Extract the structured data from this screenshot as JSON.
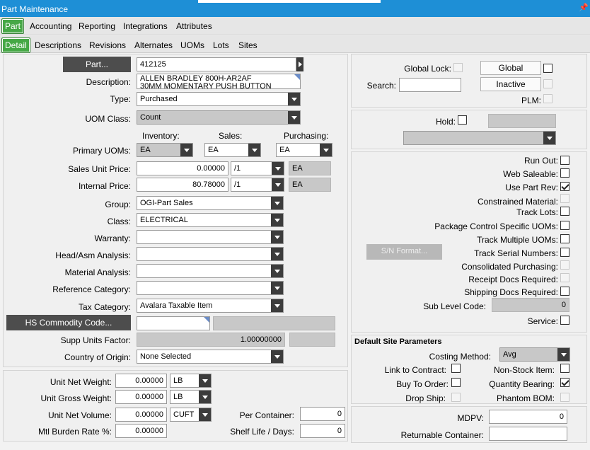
{
  "window": {
    "title": "Part Maintenance",
    "pin_icon": "pin-icon"
  },
  "tabs_main": [
    "Part",
    "Accounting",
    "Reporting",
    "Integrations",
    "Attributes"
  ],
  "tabs_sub": [
    "Detail",
    "Descriptions",
    "Revisions",
    "Alternates",
    "UOMs",
    "Lots",
    "Sites"
  ],
  "part": {
    "part_button": "Part...",
    "part_number": "412125",
    "description_label": "Description:",
    "description_line1": "ALLEN BRADLEY 800H-AR2AF",
    "description_line2": "30MM MOMENTARY PUSH BUTTON",
    "type_label": "Type:",
    "type_value": "Purchased",
    "uom_class_label": "UOM Class:",
    "uom_class_value": "Count",
    "col_inventory": "Inventory:",
    "col_sales": "Sales:",
    "col_purchasing": "Purchasing:",
    "primary_uoms_label": "Primary UOMs:",
    "uom_inventory": "EA",
    "uom_sales": "EA",
    "uom_purchasing": "EA",
    "sales_unit_price_label": "Sales Unit Price:",
    "sales_unit_price": "0.00000",
    "sales_per": "/1",
    "sales_uom": "EA",
    "internal_price_label": "Internal Price:",
    "internal_price": "80.78000",
    "internal_per": "/1",
    "internal_uom": "EA",
    "group_label": "Group:",
    "group_value": "OGI-Part Sales",
    "class_label": "Class:",
    "class_value": "ELECTRICAL",
    "warranty_label": "Warranty:",
    "head_asm_label": "Head/Asm Analysis:",
    "material_analysis_label": "Material Analysis:",
    "reference_category_label": "Reference Category:",
    "tax_category_label": "Tax Category:",
    "tax_category_value": "Avalara Taxable Item",
    "hs_button": "HS Commodity Code...",
    "supp_units_label": "Supp Units Factor:",
    "supp_units_value": "1.00000000",
    "country_label": "Country of Origin:",
    "country_value": "None Selected"
  },
  "weights": {
    "net_weight_label": "Unit Net Weight:",
    "net_weight": "0.00000",
    "net_weight_uom": "LB",
    "gross_weight_label": "Unit Gross Weight:",
    "gross_weight": "0.00000",
    "gross_weight_uom": "LB",
    "net_volume_label": "Unit Net Volume:",
    "net_volume": "0.00000",
    "net_volume_uom": "CUFT",
    "burden_label": "Mtl Burden Rate %:",
    "burden": "0.00000",
    "per_container_label": "Per Container:",
    "per_container": "0",
    "shelf_life_label": "Shelf Life / Days:",
    "shelf_life": "0"
  },
  "right_top": {
    "global_lock_label": "Global Lock:",
    "global_button": "Global",
    "search_label": "Search:",
    "inactive_button": "Inactive",
    "plm_label": "PLM:"
  },
  "hold": {
    "hold_label": "Hold:"
  },
  "flags": {
    "run_out": "Run Out:",
    "web_saleable": "Web Saleable:",
    "use_part_rev": "Use Part Rev:",
    "constrained_material": "Constrained Material:",
    "track_lots": "Track Lots:",
    "package_control": "Package Control Specific UOMs:",
    "sn_format_button": "S/N Format...",
    "track_multiple_uoms": "Track Multiple UOMs:",
    "track_serial_numbers": "Track Serial Numbers:",
    "consolidated_purchasing": "Consolidated Purchasing:",
    "receipt_docs": "Receipt Docs Required:",
    "shipping_docs": "Shipping Docs Required:",
    "sub_level_code_label": "Sub Level Code:",
    "sub_level_code": "0",
    "service": "Service:"
  },
  "site_params": {
    "header": "Default Site Parameters",
    "costing_method_label": "Costing Method:",
    "costing_method": "Avg",
    "link_to_contract": "Link to Contract:",
    "non_stock_item": "Non-Stock Item:",
    "buy_to_order": "Buy To Order:",
    "quantity_bearing": "Quantity Bearing:",
    "drop_ship": "Drop Ship:",
    "phantom_bom": "Phantom BOM:"
  },
  "bottom_right": {
    "mdpv_label": "MDPV:",
    "mdpv": "0",
    "returnable_label": "Returnable Container:"
  }
}
